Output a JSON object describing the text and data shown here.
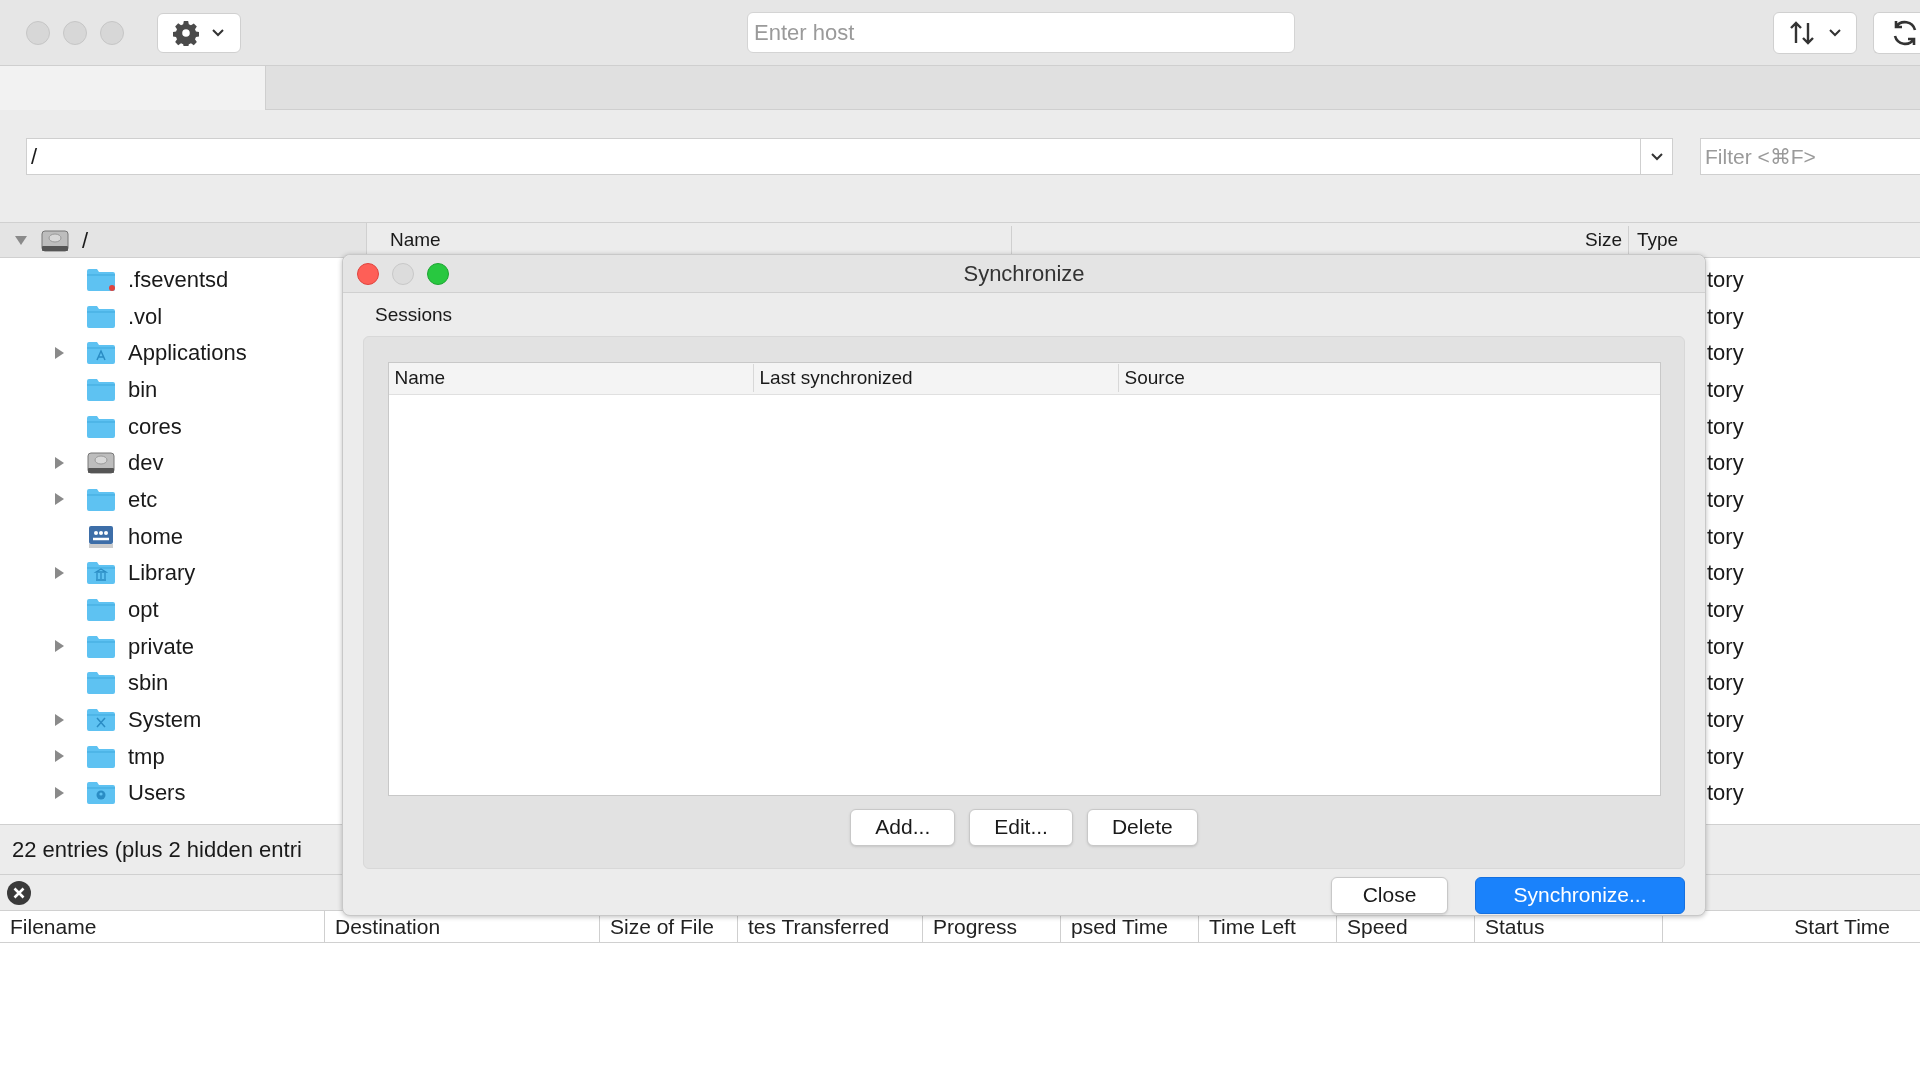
{
  "toolbar": {
    "host_field": {
      "placeholder": "Enter host"
    }
  },
  "path_bar": {
    "path": "/",
    "filter": {
      "placeholder": "Filter <⌘F>"
    }
  },
  "tree": {
    "root": {
      "label": "/",
      "expanded": true,
      "children": [
        {
          "label": ".fseventsd",
          "kind": "folder-locked",
          "has_children": false
        },
        {
          "label": ".vol",
          "kind": "folder",
          "has_children": false
        },
        {
          "label": "Applications",
          "kind": "apps-folder",
          "has_children": true
        },
        {
          "label": "bin",
          "kind": "folder",
          "has_children": false
        },
        {
          "label": "cores",
          "kind": "folder",
          "has_children": false
        },
        {
          "label": "dev",
          "kind": "drive",
          "has_children": true
        },
        {
          "label": "etc",
          "kind": "folder",
          "has_children": true
        },
        {
          "label": "home",
          "kind": "network",
          "has_children": false
        },
        {
          "label": "Library",
          "kind": "library-folder",
          "has_children": true
        },
        {
          "label": "opt",
          "kind": "folder",
          "has_children": false
        },
        {
          "label": "private",
          "kind": "folder",
          "has_children": true
        },
        {
          "label": "sbin",
          "kind": "folder",
          "has_children": false
        },
        {
          "label": "System",
          "kind": "system-folder",
          "has_children": true
        },
        {
          "label": "tmp",
          "kind": "folder",
          "has_children": true
        },
        {
          "label": "Users",
          "kind": "users-folder",
          "has_children": true
        }
      ]
    }
  },
  "file_list": {
    "columns": [
      "Name",
      "Size",
      "Type"
    ],
    "rows": [
      {
        "type": "tory"
      },
      {
        "type": "tory"
      },
      {
        "type": "tory"
      },
      {
        "type": "tory"
      },
      {
        "type": "tory"
      },
      {
        "type": "tory"
      },
      {
        "type": "tory"
      },
      {
        "type": "tory"
      },
      {
        "type": "tory"
      },
      {
        "type": "tory"
      },
      {
        "type": "tory"
      },
      {
        "type": "tory"
      },
      {
        "type": "tory"
      },
      {
        "type": "tory"
      },
      {
        "type": "tory"
      }
    ]
  },
  "status_bar": "22 entries (plus 2 hidden entri",
  "transfers": {
    "columns": [
      "Filename",
      "Destination",
      "Size of File",
      "tes Transferred",
      "Progress",
      "psed Time",
      "Time Left",
      "Speed",
      "Status",
      "Start Time"
    ]
  },
  "dialog": {
    "title": "Synchronize",
    "section": "Sessions",
    "columns": [
      "Name",
      "Last synchronized",
      "Source"
    ],
    "table_buttons": [
      "Add...",
      "Edit...",
      "Delete"
    ],
    "buttons": [
      {
        "label": "Close",
        "default": false
      },
      {
        "label": "Synchronize...",
        "default": true
      }
    ]
  }
}
